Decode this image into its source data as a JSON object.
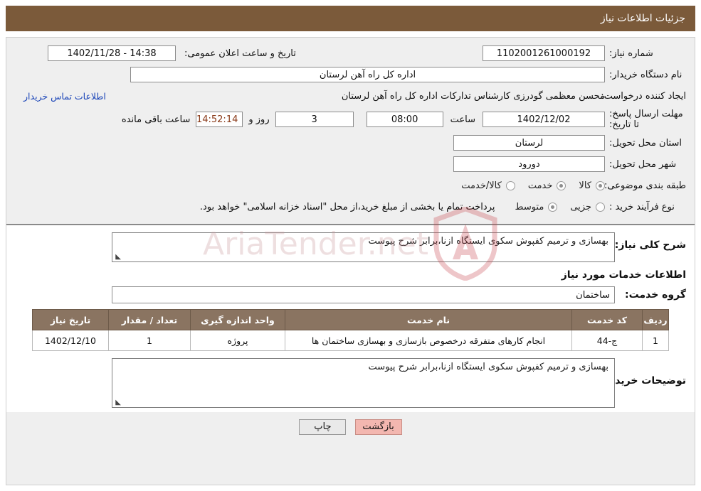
{
  "header": {
    "title": "جزئیات اطلاعات نیاز"
  },
  "info": {
    "need_number_label": "شماره نیاز:",
    "need_number_value": "1102001261000192",
    "public_announce_label": "تاریخ و ساعت اعلان عمومی:",
    "public_announce_value": "14:38 - 1402/11/28",
    "buyer_org_label": "نام دستگاه خریدار:",
    "buyer_org_value": "اداره کل راه آهن لرستان",
    "creator_label": "ایجاد کننده درخواست:",
    "creator_value": "محسن معظمی گودرزی کارشناس تدارکات اداره کل راه آهن لرستان",
    "contact_link": "اطلاعات تماس خریدار",
    "deadline_label": "مهلت ارسال پاسخ: تا تاریخ:",
    "deadline_date": "1402/12/02",
    "hour_label": "ساعت",
    "deadline_time": "08:00",
    "days_value": "3",
    "days_label": "روز و",
    "countdown_value": "14:52:14",
    "remaining_label": "ساعت باقی مانده",
    "province_label": "استان محل تحویل:",
    "province_value": "لرستان",
    "city_label": "شهر محل تحویل:",
    "city_value": "دورود",
    "category_label": "طبقه بندی موضوعی:",
    "category_options": [
      {
        "label": "کالا",
        "selected": false
      },
      {
        "label": "خدمت",
        "selected": true
      },
      {
        "label": "کالا/خدمت",
        "selected": false
      }
    ],
    "process_label": "نوع فرآیند خرید :",
    "process_options": [
      {
        "label": "جزیی",
        "selected": false
      },
      {
        "label": "متوسط",
        "selected": true
      }
    ],
    "process_note": "پرداخت تمام یا بخشی از مبلغ خرید،از محل \"اسناد خزانه اسلامی\" خواهد بود."
  },
  "main": {
    "general_desc_label": "شرح کلی نیاز:",
    "general_desc_value": "بهسازی و ترمیم کفپوش سکوی ایستگاه ازنا،برابر شرح پیوست",
    "services_heading": "اطلاعات خدمات مورد نیاز",
    "service_group_label": "گروه خدمت:",
    "service_group_value": "ساختمان",
    "table": {
      "columns": [
        "ردیف",
        "کد خدمت",
        "نام خدمت",
        "واحد اندازه گیری",
        "تعداد / مقدار",
        "تاریخ نیاز"
      ],
      "rows": [
        [
          "1",
          "ج-44",
          "انجام کارهای متفرقه درخصوص بازسازی و بهسازی ساختمان ها",
          "پروژه",
          "1",
          "1402/12/10"
        ]
      ]
    },
    "buyer_notes_label": "توضیحات خریدار:",
    "buyer_notes_value": "بهسازی و ترمیم کفپوش سکوی ایستگاه ازنا،برابر شرح پیوست"
  },
  "footer": {
    "print_label": "چاپ",
    "back_label": "بازگشت"
  },
  "watermark": {
    "text": "AriaTender.net"
  }
}
